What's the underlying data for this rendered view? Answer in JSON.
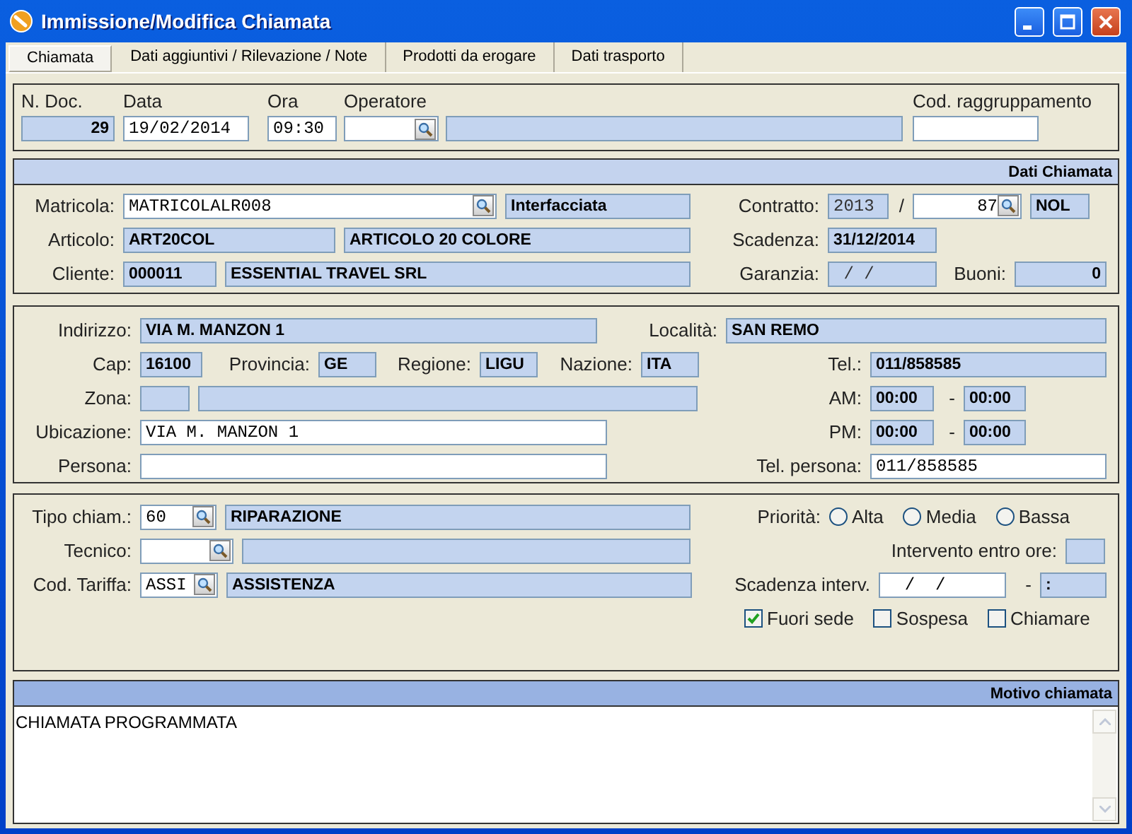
{
  "window": {
    "title": "Immissione/Modifica Chiamata"
  },
  "tabs": [
    {
      "label": "Chiamata",
      "selected": true
    },
    {
      "label": "Dati aggiuntivi / Rilevazione / Note",
      "selected": false
    },
    {
      "label": "Prodotti da erogare",
      "selected": false
    },
    {
      "label": "Dati trasporto",
      "selected": false
    }
  ],
  "header": {
    "fields": [
      {
        "label": "N. Doc.",
        "value": "29",
        "readonly": true
      },
      {
        "label": "Data",
        "value": "19/02/2014",
        "readonly": false
      },
      {
        "label": "Ora",
        "value": "09:30",
        "readonly": false
      },
      {
        "label": "Operatore",
        "readonly": false,
        "lookup": true
      },
      {
        "readonly": true
      },
      {
        "label": "Cod. raggruppamento",
        "readonly": false
      }
    ]
  },
  "sections": [
    {
      "title": "Dati Chiamata",
      "rows": [
        {
          "left": [
            {
              "kind": "label",
              "text": "Matricola:"
            },
            {
              "kind": "field",
              "value": "MATRICOLALR008",
              "readonly": false,
              "lookup": true
            },
            {
              "kind": "field",
              "value": "Interfacciata",
              "readonly": true
            }
          ],
          "right": [
            {
              "kind": "label",
              "text": "Contratto:"
            },
            {
              "kind": "field",
              "value": "2013",
              "readonly": true
            },
            {
              "kind": "text",
              "text": "/"
            },
            {
              "kind": "field",
              "value": "87",
              "readonly": false,
              "lookup": true
            },
            {
              "kind": "field",
              "value": "NOL",
              "readonly": true
            }
          ]
        },
        {
          "left": [
            {
              "kind": "label",
              "text": "Articolo:"
            },
            {
              "kind": "field",
              "value": "ART20COL",
              "readonly": true
            },
            {
              "kind": "field",
              "value": "ARTICOLO 20 COLORE",
              "readonly": true
            }
          ],
          "right": [
            {
              "kind": "label",
              "text": "Scadenza:"
            },
            {
              "kind": "field",
              "value": "31/12/2014",
              "readonly": true
            }
          ]
        },
        {
          "left": [
            {
              "kind": "label",
              "text": "Cliente:"
            },
            {
              "kind": "field",
              "value": "000011",
              "readonly": true
            },
            {
              "kind": "field",
              "value": "ESSENTIAL TRAVEL SRL",
              "readonly": true
            }
          ],
          "right": [
            {
              "kind": "label",
              "text": "Garanzia:"
            },
            {
              "kind": "field",
              "value": " / /",
              "readonly": true
            },
            {
              "kind": "text",
              "text": "Buoni:"
            },
            {
              "kind": "field",
              "value": "0",
              "readonly": true
            }
          ]
        }
      ]
    },
    {
      "rows": [
        {
          "left": [
            {
              "kind": "label",
              "text": "Indirizzo:"
            },
            {
              "kind": "field",
              "value": "VIA M. MANZON 1",
              "readonly": true
            },
            {
              "kind": "text",
              "text": "Località:"
            },
            {
              "kind": "field",
              "value": "SAN REMO",
              "readonly": true
            }
          ]
        },
        {
          "left": [
            {
              "kind": "label",
              "text": "Cap:"
            },
            {
              "kind": "field",
              "value": "16100",
              "readonly": true
            },
            {
              "kind": "text",
              "text": "Provincia:"
            },
            {
              "kind": "field",
              "value": "GE",
              "readonly": true
            },
            {
              "kind": "text",
              "text": "Regione:"
            },
            {
              "kind": "field",
              "value": "LIGU",
              "readonly": true
            },
            {
              "kind": "text",
              "text": "Nazione:"
            },
            {
              "kind": "field",
              "value": "ITA",
              "readonly": true
            }
          ],
          "right": [
            {
              "kind": "label",
              "text": "Tel.:"
            },
            {
              "kind": "field",
              "value": "011/858585",
              "readonly": true
            }
          ]
        },
        {
          "left": [
            {
              "kind": "label",
              "text": "Zona:"
            },
            {
              "kind": "field",
              "readonly": true
            },
            {
              "kind": "field",
              "readonly": true
            }
          ],
          "right": [
            {
              "kind": "label",
              "text": "AM:"
            },
            {
              "kind": "field",
              "value": "00:00",
              "readonly": true
            },
            {
              "kind": "text",
              "text": "-"
            },
            {
              "kind": "field",
              "value": "00:00",
              "readonly": true
            }
          ]
        },
        {
          "left": [
            {
              "kind": "label",
              "text": "Ubicazione:"
            },
            {
              "kind": "field",
              "value": "VIA M. MANZON 1",
              "readonly": false
            }
          ],
          "right": [
            {
              "kind": "label",
              "text": "PM:"
            },
            {
              "kind": "field",
              "value": "00:00",
              "readonly": true
            },
            {
              "kind": "text",
              "text": "-"
            },
            {
              "kind": "field",
              "value": "00:00",
              "readonly": true
            }
          ]
        },
        {
          "left": [
            {
              "kind": "label",
              "text": "Persona:"
            },
            {
              "kind": "field",
              "readonly": false
            }
          ],
          "right": [
            {
              "kind": "label",
              "text": "Tel. persona:"
            },
            {
              "kind": "field",
              "value": "011/858585",
              "readonly": false
            }
          ]
        }
      ]
    },
    {
      "rows": [
        {
          "left": [
            {
              "kind": "label",
              "text": "Tipo chiam.:"
            },
            {
              "kind": "field",
              "value": "60",
              "readonly": false,
              "lookup": true
            },
            {
              "kind": "field",
              "value": "RIPARAZIONE",
              "readonly": true
            }
          ],
          "right": [
            {
              "kind": "label",
              "text": "Priorità:"
            },
            {
              "kind": "radio",
              "text": "Alta",
              "selected": false
            },
            {
              "kind": "radio",
              "text": "Media",
              "selected": false
            },
            {
              "kind": "radio",
              "text": "Bassa",
              "selected": false
            }
          ]
        },
        {
          "left": [
            {
              "kind": "label",
              "text": "Tecnico:"
            },
            {
              "kind": "field",
              "readonly": false,
              "lookup": true
            },
            {
              "kind": "field",
              "readonly": true
            }
          ],
          "right": [
            {
              "kind": "label",
              "text": "Intervento entro ore:"
            },
            {
              "kind": "field",
              "readonly": true
            }
          ]
        },
        {
          "left": [
            {
              "kind": "label",
              "text": "Cod. Tariffa:"
            },
            {
              "kind": "field",
              "value": "ASSI",
              "readonly": false,
              "lookup": true
            },
            {
              "kind": "field",
              "value": "ASSISTENZA",
              "readonly": true
            }
          ],
          "right": [
            {
              "kind": "label",
              "text": "Scadenza interv."
            },
            {
              "kind": "field",
              "value": "  /  /",
              "readonly": false
            },
            {
              "kind": "text",
              "text": "-"
            },
            {
              "kind": "field",
              "value": ":",
              "readonly": true
            }
          ]
        },
        {
          "right": [
            {
              "kind": "checkbox",
              "text": "Fuori sede",
              "checked": true
            },
            {
              "kind": "checkbox",
              "text": "Sospesa",
              "checked": false
            },
            {
              "kind": "checkbox",
              "text": "Chiamare",
              "checked": false
            }
          ]
        }
      ]
    }
  ],
  "motivo": {
    "title": "Motivo chiamata",
    "text": "CHIAMATA PROGRAMMATA"
  }
}
